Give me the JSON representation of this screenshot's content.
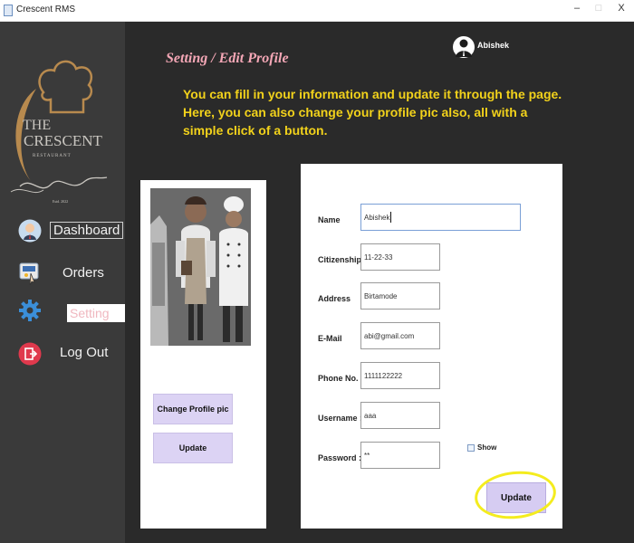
{
  "window": {
    "title": "Crescent RMS",
    "minimize": "–",
    "maximize": "□",
    "close": "X"
  },
  "logo": {
    "line1": "THE",
    "line2": "CRESCENT",
    "line3": "RESTAURANT",
    "line4": "Estd. 2022"
  },
  "sidebar": {
    "items": [
      {
        "label": "Dashboard",
        "icon": "user-tie-icon",
        "state": "default"
      },
      {
        "label": "Orders",
        "icon": "order-cart-icon",
        "state": "default"
      },
      {
        "label": "Setting",
        "icon": "gear-icon",
        "state": "active"
      },
      {
        "label": "Log Out",
        "icon": "logout-icon",
        "state": "default"
      }
    ]
  },
  "header": {
    "title": "Setting / Edit Profile",
    "user_name": "Abishek"
  },
  "note": {
    "line1": "You can fill in your information and update it through the page.",
    "line2": "Here, you can also change your profile pic also, all with a simple click of a button."
  },
  "profile": {
    "change_pic_label": "Change Profile pic",
    "update_label": "Update"
  },
  "form": {
    "name": {
      "label": "Name",
      "value": "Abishek"
    },
    "citizenship": {
      "label": "Citizenship",
      "value": "11-22-33"
    },
    "address": {
      "label": "Address",
      "value": "Birtamode"
    },
    "email": {
      "label": "E-Mail",
      "value": "abi@gmail.com"
    },
    "phone": {
      "label": "Phone No.",
      "value": "1111122222"
    },
    "username": {
      "label": "Username :",
      "value": "aaa"
    },
    "password": {
      "label": "Password :",
      "value": "**"
    },
    "show_label": "Show",
    "update_label": "Update"
  },
  "colors": {
    "sidebar": "#3a3a3a",
    "main": "#2a2a2a",
    "heading": "#f4a7b6",
    "note": "#f2d21b",
    "button": "#dcd3f4",
    "highlight": "#f4ec1e"
  }
}
